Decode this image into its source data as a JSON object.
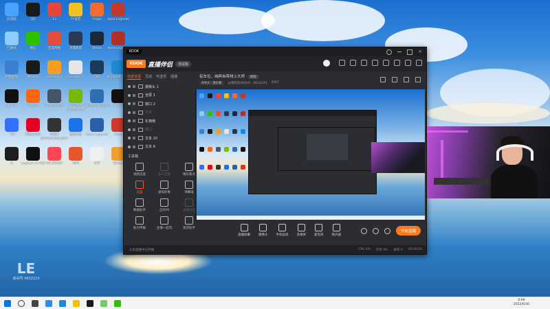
{
  "desktop": {
    "icons": [
      {
        "label": "此电脑",
        "color": "#4aa3ff"
      },
      {
        "label": "QQ",
        "color": "#1a1a1a"
      },
      {
        "label": "13",
        "color": "#e8463c"
      },
      {
        "label": "YY语音",
        "color": "#f4c21c"
      },
      {
        "label": "Origin",
        "color": "#f56c2d"
      },
      {
        "label": "Apex Legends",
        "color": "#c0392b"
      },
      {
        "label": "回收站",
        "color": "#8ecbff"
      },
      {
        "label": "微信",
        "color": "#2dc100"
      },
      {
        "label": "百度网盘",
        "color": "#e34e3c"
      },
      {
        "label": "英雄联盟",
        "color": "#2a3a55"
      },
      {
        "label": "Steam",
        "color": "#1b2838"
      },
      {
        "label": "Apex Legends",
        "color": "#b03027"
      },
      {
        "label": "控制面板",
        "color": "#3c7fd1"
      },
      {
        "label": "腾讯QQ",
        "color": "#1a1a1a"
      },
      {
        "label": "Overwatch",
        "color": "#f99e1a"
      },
      {
        "label": "Overwatch",
        "color": "#e6e6e6"
      },
      {
        "label": "OBS",
        "color": "#1c3b5a"
      },
      {
        "label": "Microsoft Edge",
        "color": "#1f8ad2"
      },
      {
        "label": "CapCut",
        "color": "#111111"
      },
      {
        "label": "Firefox",
        "color": "#ff6611"
      },
      {
        "label": "Honeycomb",
        "color": "#445566"
      },
      {
        "label": "GeForce Experience",
        "color": "#76b900"
      },
      {
        "label": "Wallpaper Engine",
        "color": "#2d6fb0"
      },
      {
        "label": "KOOK",
        "color": "#111111"
      },
      {
        "label": "飞书",
        "color": "#3370ff"
      },
      {
        "label": "网易云音乐",
        "color": "#e60026"
      },
      {
        "label": "PUBG BATTLEGROUNDS",
        "color": "#333333"
      },
      {
        "label": "直播伴侣",
        "color": "#1a73e8"
      },
      {
        "label": "Apex Legends",
        "color": "#2b5fa8"
      },
      {
        "label": "Hero",
        "color": "#cc3b2b"
      },
      {
        "label": "G",
        "color": "#1e1e1e"
      },
      {
        "label": "Logitech G HUB",
        "color": "#111111"
      },
      {
        "label": "VALORANT",
        "color": "#ff4655"
      },
      {
        "label": "WPS",
        "color": "#e6582c"
      },
      {
        "label": "文件",
        "color": "#f0f0f0"
      },
      {
        "label": "ToDesk",
        "color": "#f0a030"
      }
    ],
    "watermark_big": "LE",
    "watermark_small": "房间号 4632223"
  },
  "window": {
    "brand_logo": "KOOK",
    "brand_name": "直播伴侣",
    "version_label": "测试版",
    "left_tabs": [
      "场景资源",
      "互动",
      "可选项",
      "插播"
    ],
    "sources": [
      {
        "label": "摄像头 1",
        "dim": false
      },
      {
        "label": "全屏 1",
        "dim": false
      },
      {
        "label": "窗口 2",
        "dim": false
      },
      {
        "label": "文本",
        "dim": true
      },
      {
        "label": "礼物榜",
        "dim": false
      },
      {
        "label": "窗口",
        "dim": true
      },
      {
        "label": "文本 10",
        "dim": false
      },
      {
        "label": "文本 8",
        "dim": false
      }
    ],
    "tools_title": "工具箱",
    "tools": [
      {
        "label": "视频连麦",
        "state": "normal"
      },
      {
        "label": "多人连麦",
        "state": "dim"
      },
      {
        "label": "精彩看点",
        "state": "normal"
      },
      {
        "label": "设置",
        "state": "hot"
      },
      {
        "label": "虚拟形象",
        "state": "normal"
      },
      {
        "label": "弹幕墙",
        "state": "normal"
      },
      {
        "label": "数据助手",
        "state": "normal"
      },
      {
        "label": "全民PK",
        "state": "normal"
      },
      {
        "label": "主播主页",
        "state": "dim"
      },
      {
        "label": "助力申报",
        "state": "normal"
      },
      {
        "label": "主播一起玩",
        "state": "normal"
      },
      {
        "label": "发货助手",
        "state": "normal"
      }
    ],
    "room_title": "有车位，纯粹自带排上大师",
    "room_tag": "修改",
    "category": "APEX · 顶尖者",
    "room_id": "@我的房间QVQ · 4632223",
    "viewers": "4567",
    "bottom_actions": [
      "直播屏幕",
      "摄像头",
      "手机投屏",
      "多媒体",
      "麦克风",
      "扬声器"
    ],
    "start_button": "开始直播",
    "status_left": "头条直播中已开播",
    "status_right": [
      "CPU 0%",
      "内存 0%",
      "帧率 0",
      "00:00:00"
    ]
  },
  "taskbar": {
    "time": "0:09",
    "date": "2022/6/30"
  }
}
